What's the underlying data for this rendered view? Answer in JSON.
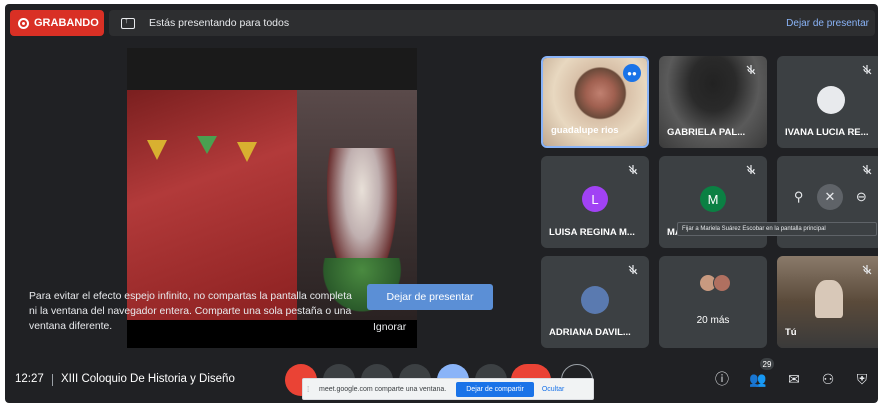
{
  "recording": {
    "label": "GRABANDO",
    "color": "#d93025"
  },
  "presenting": {
    "message": "Estás presentando para todos",
    "stop_link": "Dejar de presentar"
  },
  "presentation_hint": {
    "text": "Para evitar el efecto espejo infinito, no compartas la pantalla completa ni la ventana del navegador entera. Comparte una sola pestaña o una ventana diferente.",
    "stop_button": "Dejar de presentar",
    "ignore_button": "Ignorar"
  },
  "participants": [
    {
      "name": "guadalupe rios",
      "speaking": true
    },
    {
      "name": "GABRIELA PAL...",
      "muted": true
    },
    {
      "name": "IVANA LUCIA RE...",
      "muted": true
    },
    {
      "name": "LUISA REGINA M...",
      "initial": "L",
      "avatar_color": "#a142f4",
      "muted": true
    },
    {
      "name": "MARIA",
      "initial": "M",
      "avatar_color": "#0b8043",
      "muted": true
    },
    {
      "name": "",
      "muted": true
    },
    {
      "name": "ADRIANA DAVIL...",
      "muted": true
    },
    {
      "name": "20 más"
    },
    {
      "name": "Tú",
      "muted": true
    }
  ],
  "tooltip": "Fijar a Mariela Suárez Escobar en la pantalla principal",
  "bottom": {
    "time": "12:27",
    "meeting_title": "XIII Coloquio De Historia y Diseño",
    "participant_count": "29"
  },
  "share_bar": {
    "message": "meet.google.com comparte una ventana.",
    "stop_label": "Dejar de compartir",
    "hide_label": "Ocultar"
  }
}
